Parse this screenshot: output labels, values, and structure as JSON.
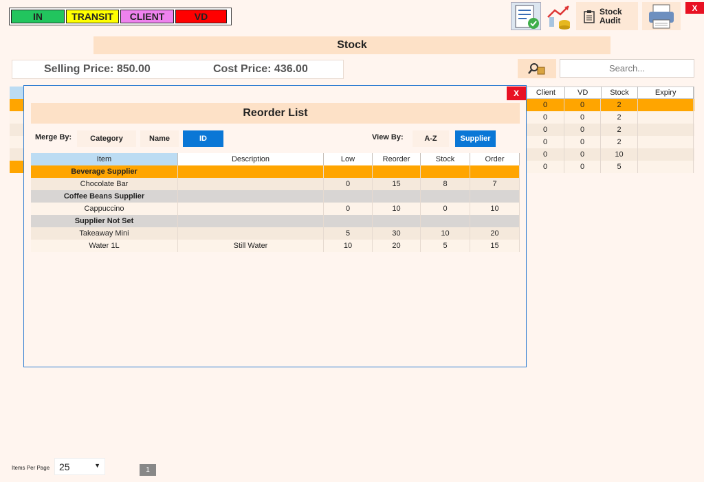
{
  "legend": {
    "items": [
      {
        "label": "IN",
        "color": "#22c55e"
      },
      {
        "label": "TRANSIT",
        "color": "#ffff00"
      },
      {
        "label": "CLIENT",
        "color": "#ee82ee"
      },
      {
        "label": "VD",
        "color": "#ff0000"
      }
    ]
  },
  "toolbar": {
    "audit_line1": "Stock",
    "audit_line2": "Audit",
    "close_label": "X"
  },
  "page_title": "Stock",
  "prices": {
    "selling": "Selling Price: 850.00",
    "cost": "Cost Price: 436.00"
  },
  "search": {
    "placeholder": "Search..."
  },
  "background_table": {
    "headers": [
      "Client",
      "VD",
      "Stock",
      "Expiry"
    ],
    "rows": [
      {
        "client": "0",
        "vd": "0",
        "stock": "2",
        "expiry": ""
      },
      {
        "client": "0",
        "vd": "0",
        "stock": "2",
        "expiry": ""
      },
      {
        "client": "0",
        "vd": "0",
        "stock": "2",
        "expiry": ""
      },
      {
        "client": "0",
        "vd": "0",
        "stock": "2",
        "expiry": ""
      },
      {
        "client": "0",
        "vd": "0",
        "stock": "10",
        "expiry": ""
      },
      {
        "client": "0",
        "vd": "0",
        "stock": "5",
        "expiry": ""
      }
    ]
  },
  "modal": {
    "close_label": "X",
    "title": "Reorder List",
    "merge_by_label": "Merge By:",
    "merge_options": [
      "Category",
      "Name",
      "ID"
    ],
    "view_by_label": "View By:",
    "view_options": [
      "A-Z",
      "Supplier"
    ],
    "table": {
      "headers": [
        "Item",
        "Description",
        "Low",
        "Reorder",
        "Stock",
        "Order"
      ],
      "rows": [
        {
          "type": "group",
          "item": "Beverage Supplier"
        },
        {
          "type": "item",
          "item": "Chocolate Bar",
          "description": "",
          "low": "0",
          "reorder": "15",
          "stock": "8",
          "order": "7"
        },
        {
          "type": "group",
          "item": "Coffee Beans Supplier"
        },
        {
          "type": "item",
          "item": "Cappuccino",
          "description": "",
          "low": "0",
          "reorder": "10",
          "stock": "0",
          "order": "10"
        },
        {
          "type": "group",
          "item": "Supplier Not Set"
        },
        {
          "type": "item",
          "item": "Takeaway Mini",
          "description": "",
          "low": "5",
          "reorder": "30",
          "stock": "10",
          "order": "20"
        },
        {
          "type": "item",
          "item": "Water 1L",
          "description": "Still Water",
          "low": "10",
          "reorder": "20",
          "stock": "5",
          "order": "15"
        }
      ]
    }
  },
  "footer": {
    "items_per_page_label": "Items Per Page",
    "items_per_page_value": "25",
    "page_number": "1"
  }
}
